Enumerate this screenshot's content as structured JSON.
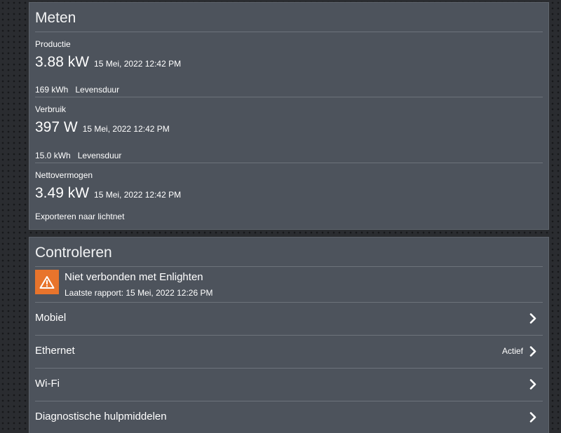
{
  "meten": {
    "title": "Meten",
    "productie": {
      "label": "Productie",
      "value": "3.88 kW",
      "timestamp": "15 Mei, 2022 12:42 PM",
      "lifetime_value": "169 kWh",
      "lifetime_label": "Levensduur"
    },
    "verbruik": {
      "label": "Verbruik",
      "value": "397 W",
      "timestamp": "15 Mei, 2022 12:42 PM",
      "lifetime_value": "15.0 kWh",
      "lifetime_label": "Levensduur"
    },
    "netto": {
      "label": "Nettovermogen",
      "value": "3.49 kW",
      "timestamp": "15 Mei, 2022 12:42 PM",
      "status": "Exporteren naar lichtnet"
    }
  },
  "controleren": {
    "title": "Controleren",
    "warning": {
      "icon": "warning-triangle-icon",
      "color": "#e8742c",
      "title": "Niet verbonden met Enlighten",
      "subtitle": "Laatste rapport: 15 Mei, 2022 12:26 PM"
    },
    "items": [
      {
        "label": "Mobiel",
        "status": "",
        "icon": "chevron-right-icon"
      },
      {
        "label": "Ethernet",
        "status": "Actief",
        "icon": "chevron-right-icon"
      },
      {
        "label": "Wi-Fi",
        "status": "",
        "icon": "chevron-right-icon"
      },
      {
        "label": "Diagnostische hulpmiddelen",
        "status": "",
        "icon": "chevron-right-icon"
      }
    ]
  }
}
